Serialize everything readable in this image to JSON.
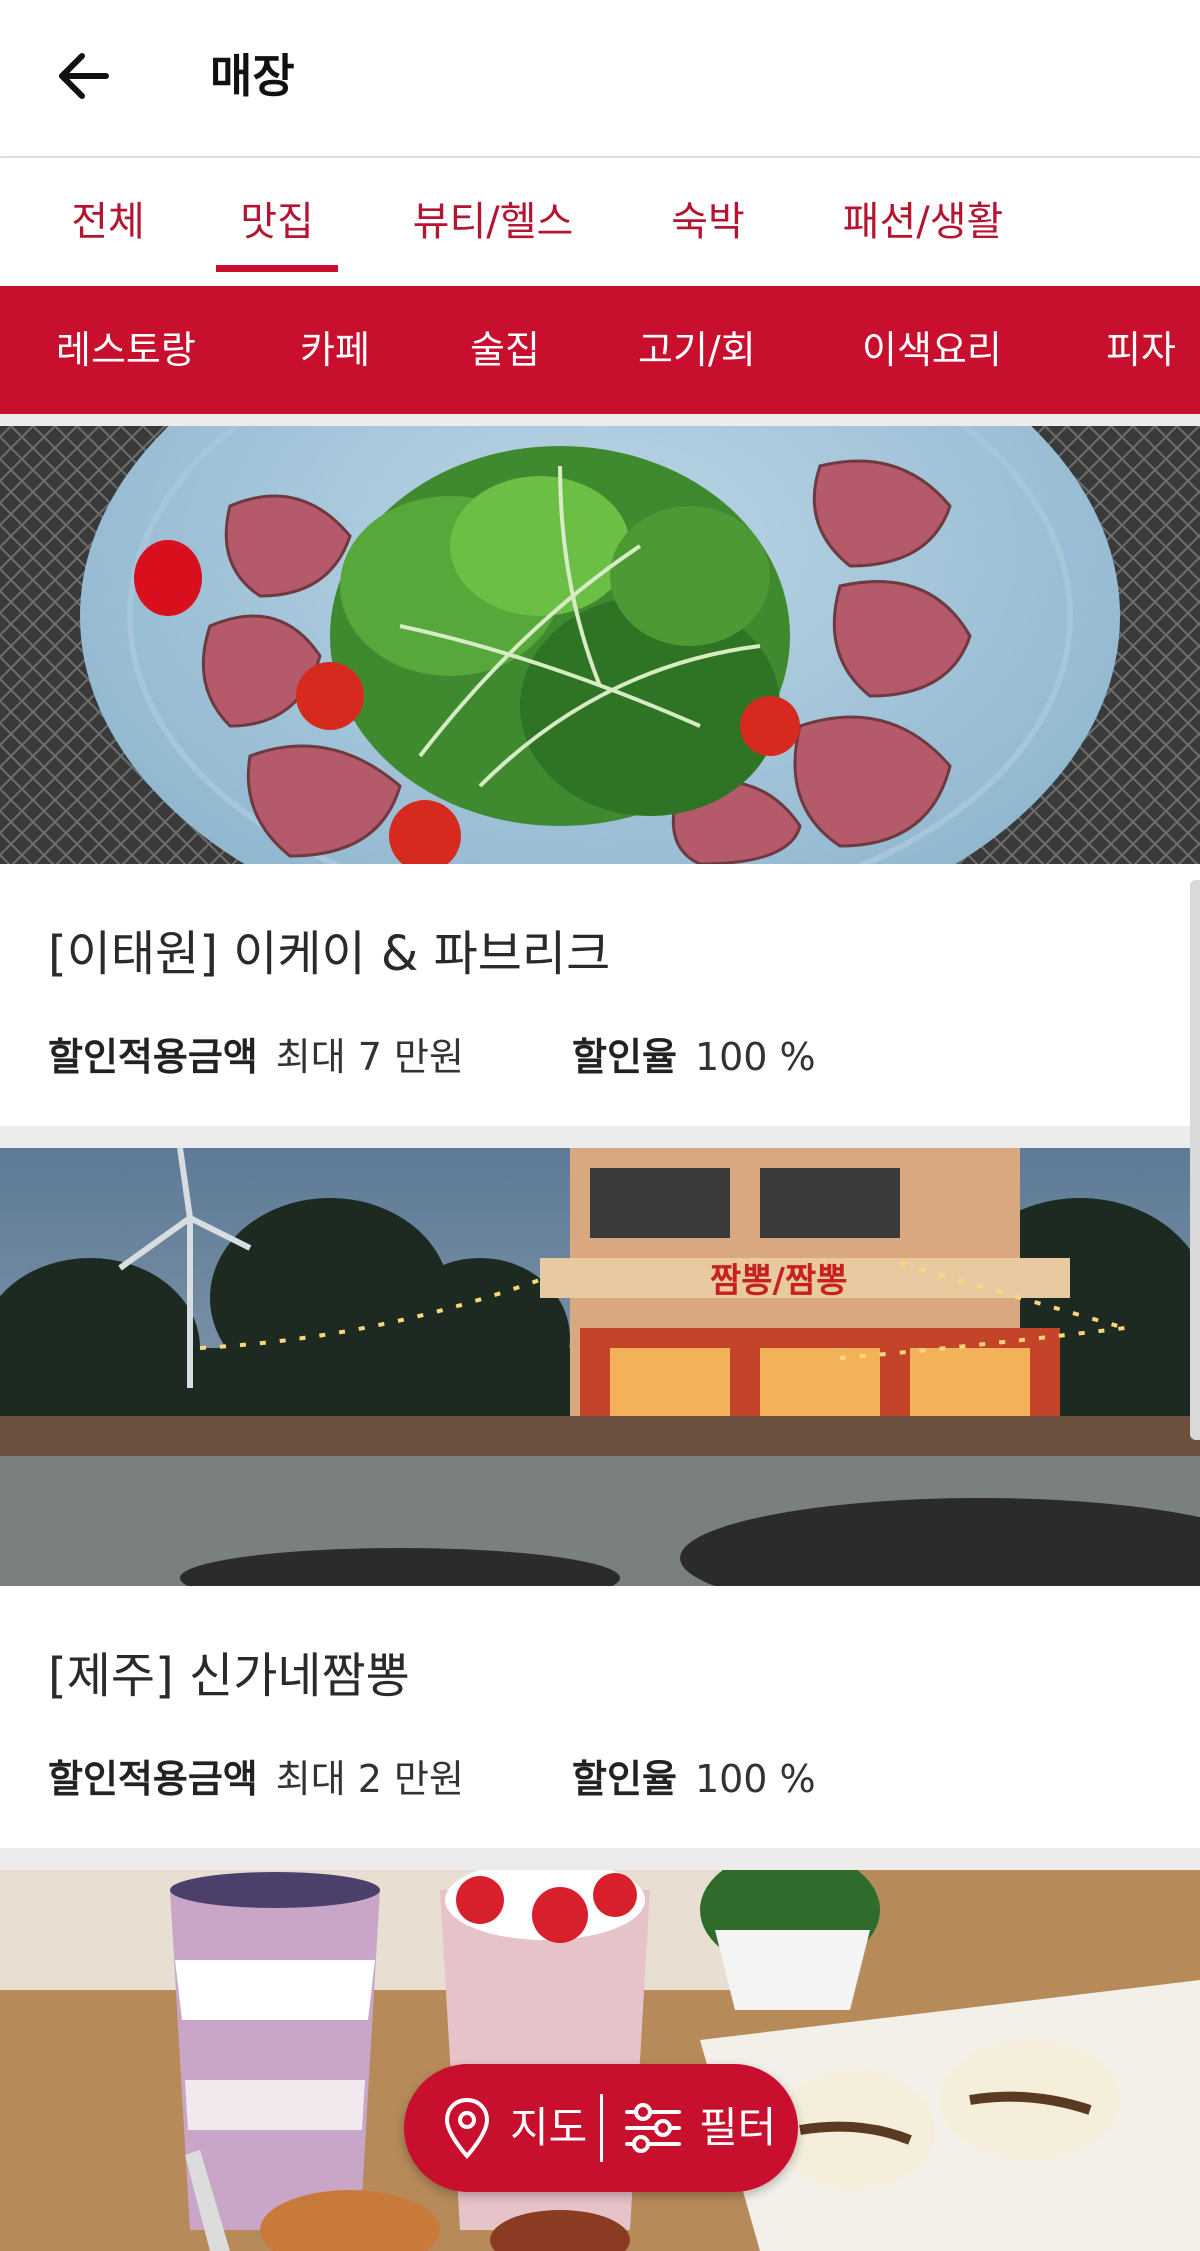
{
  "header": {
    "title": "매장"
  },
  "tabs": [
    {
      "label": "전체",
      "active": false
    },
    {
      "label": "맛집",
      "active": true
    },
    {
      "label": "뷰티/헬스",
      "active": false
    },
    {
      "label": "숙박",
      "active": false
    },
    {
      "label": "패션/생활",
      "active": false
    }
  ],
  "subcategories": [
    "레스토랑",
    "카페",
    "술집",
    "고기/회",
    "이색요리",
    "피자"
  ],
  "stores": [
    {
      "title": "[이태원] 이케이 & 파브리크",
      "discount_amount_label": "할인적용금액",
      "discount_amount_value": "최대 7 만원",
      "discount_rate_label": "할인율",
      "discount_rate_value": "100 %"
    },
    {
      "title": "[제주] 신가네짬뽕",
      "discount_amount_label": "할인적용금액",
      "discount_amount_value": "최대 2 만원",
      "discount_rate_label": "할인율",
      "discount_rate_value": "100 %"
    }
  ],
  "photo_sign": "짬뽕/짬뽕",
  "fab": {
    "map_label": "지도",
    "filter_label": "필터"
  },
  "colors": {
    "brand_red": "#c8102e",
    "tab_text": "#b51530"
  }
}
